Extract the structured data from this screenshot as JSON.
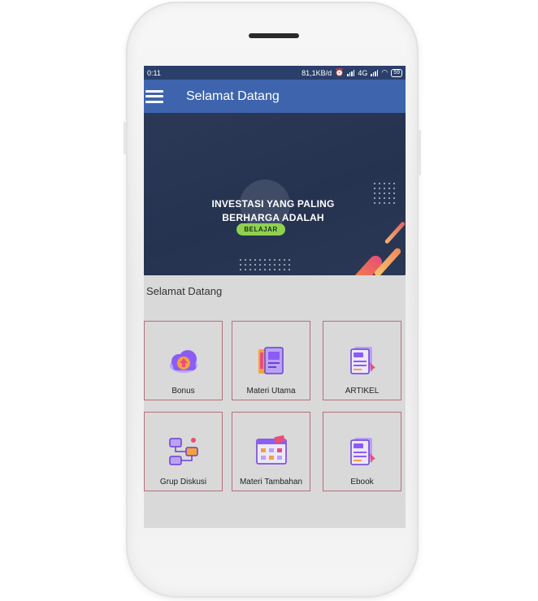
{
  "status_bar": {
    "time": "0:11",
    "speed": "81,1KB/d",
    "network": "4G",
    "battery": "59"
  },
  "toolbar": {
    "title": "Selamat Datang"
  },
  "banner": {
    "headline_line1": "INVESTASI YANG PALING",
    "headline_line2": "BERHARGA ADALAH",
    "button_label": "BELAJAR"
  },
  "section": {
    "title": "Selamat Datang"
  },
  "menu": [
    {
      "label": "Bonus",
      "icon": "cloud-upload-icon"
    },
    {
      "label": "Materi Utama",
      "icon": "book-icon"
    },
    {
      "label": "ARTIKEL",
      "icon": "document-icon"
    },
    {
      "label": "Grup Diskusi",
      "icon": "flowchart-icon"
    },
    {
      "label": "Materi Tambahan",
      "icon": "browser-window-icon"
    },
    {
      "label": "Ebook",
      "icon": "document-icon"
    }
  ],
  "colors": {
    "toolbar": "#3e64ad",
    "status_bar": "#2b3f6b",
    "tile_border": "#b46f7a",
    "button_green": "#8fd14f",
    "icon_purple": "#8b5cf6",
    "icon_orange": "#f5a23a"
  }
}
